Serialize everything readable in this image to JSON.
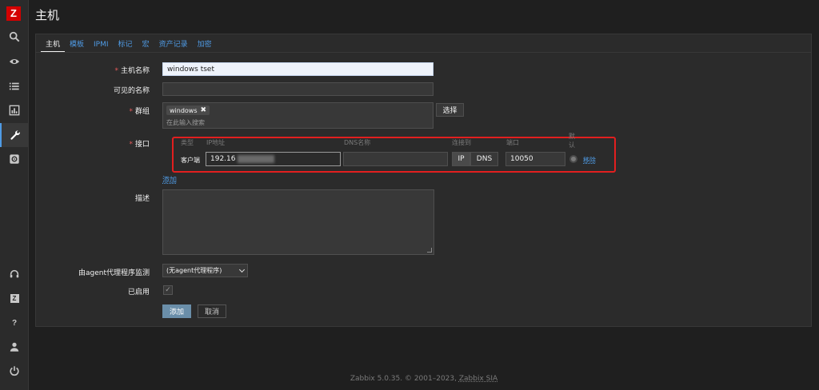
{
  "app": {
    "logo": "Z",
    "page_title": "主机"
  },
  "sidebar": {
    "items": [
      {
        "name": "search-icon",
        "glyph": "search"
      },
      {
        "name": "eye-icon",
        "glyph": "monitoring"
      },
      {
        "name": "list-icon",
        "glyph": "inventory"
      },
      {
        "name": "chart-icon",
        "glyph": "reports"
      },
      {
        "name": "wrench-icon",
        "glyph": "configuration",
        "active": true
      },
      {
        "name": "gear-icon",
        "glyph": "administration"
      }
    ],
    "bottom": [
      {
        "name": "headset-icon",
        "glyph": "support"
      },
      {
        "name": "zabbix-share-icon",
        "label": "Z"
      },
      {
        "name": "help-icon",
        "label": "?"
      },
      {
        "name": "user-icon",
        "glyph": "user"
      },
      {
        "name": "power-icon",
        "glyph": "sign-out"
      }
    ]
  },
  "tabs": [
    {
      "label": "主机",
      "active": true
    },
    {
      "label": "模板"
    },
    {
      "label": "IPMI"
    },
    {
      "label": "标记"
    },
    {
      "label": "宏"
    },
    {
      "label": "资产记录"
    },
    {
      "label": "加密"
    }
  ],
  "form": {
    "host_name_label": "主机名称",
    "host_name_value": "windows tset",
    "visible_name_label": "可见的名称",
    "visible_name_value": "",
    "groups_label": "群组",
    "group_tag": "windows",
    "group_placeholder": "在此输入搜索",
    "select_button": "选择",
    "interfaces_label": "接口",
    "interfaces": {
      "headers": {
        "type": "类型",
        "ip": "IP地址",
        "dns": "DNS名称",
        "connect_to": "连接到",
        "port": "端口",
        "default": "默认"
      },
      "row": {
        "type": "客户端",
        "ip": "192.16",
        "dns": "",
        "connect_ip": "IP",
        "connect_dns": "DNS",
        "port": "10050",
        "remove": "移除"
      },
      "add": "添加"
    },
    "description_label": "描述",
    "proxy_label": "由agent代理程序监测",
    "proxy_value": "(无agent代理程序)",
    "enabled_label": "已启用",
    "enabled_checked": true,
    "add_button": "添加",
    "cancel_button": "取消"
  },
  "footer": {
    "text": "Zabbix 5.0.35. © 2001–2023, ",
    "link": "Zabbix SIA"
  },
  "colors": {
    "accent": "#4f9be5",
    "highlight_border": "#e21f1f",
    "required": "#e45959",
    "logo_bg": "#d40000"
  }
}
